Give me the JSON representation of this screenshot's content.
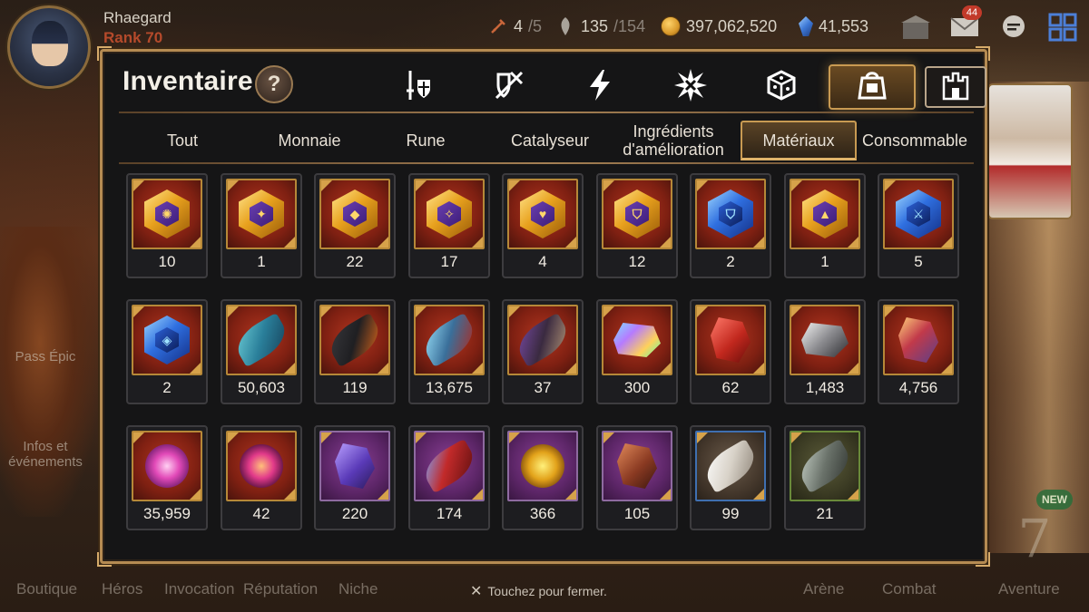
{
  "player": {
    "name": "Rhaegard",
    "rank": "Rank 70"
  },
  "resources": {
    "stamina": {
      "value": "4",
      "max": "/5"
    },
    "energy": {
      "value": "135",
      "max": "/154"
    },
    "gold": "397,062,520",
    "gems": "41,553"
  },
  "top_icons": {
    "mail_badge": "44"
  },
  "panel": {
    "title": "Inventaire",
    "help": "?"
  },
  "category_tabs": [
    {
      "icon": "sword-shield-icon",
      "active": false
    },
    {
      "icon": "crossed-swords-shield-icon",
      "active": false
    },
    {
      "icon": "lightning-icon",
      "active": false
    },
    {
      "icon": "burst-icon",
      "active": false
    },
    {
      "icon": "dice-icon",
      "active": false
    },
    {
      "icon": "backpack-icon",
      "active": true
    },
    {
      "icon": "castle-icon",
      "active": false
    }
  ],
  "sub_tabs": [
    {
      "label": "Tout",
      "active": false
    },
    {
      "label": "Monnaie",
      "active": false
    },
    {
      "label": "Rune",
      "active": false
    },
    {
      "label": "Catalyseur",
      "active": false
    },
    {
      "label": "Ingrédients d'amélioration",
      "active": false
    },
    {
      "label": "Matériaux",
      "active": true
    },
    {
      "label": "Consommable",
      "active": false
    }
  ],
  "items": [
    {
      "qty": "10",
      "kind": "rune-gold",
      "glyph": "✺",
      "bg": "red"
    },
    {
      "qty": "1",
      "kind": "rune-gold",
      "glyph": "✦",
      "bg": "red"
    },
    {
      "qty": "22",
      "kind": "rune-gold",
      "glyph": "◆",
      "bg": "red"
    },
    {
      "qty": "17",
      "kind": "rune-gold",
      "glyph": "✧",
      "bg": "red"
    },
    {
      "qty": "4",
      "kind": "rune-gold",
      "glyph": "♥",
      "bg": "red"
    },
    {
      "qty": "12",
      "kind": "rune-gold",
      "glyph": "⛉",
      "bg": "red"
    },
    {
      "qty": "2",
      "kind": "rune-blue",
      "glyph": "⛉",
      "bg": "red"
    },
    {
      "qty": "1",
      "kind": "rune-gold",
      "glyph": "▲",
      "bg": "red"
    },
    {
      "qty": "5",
      "kind": "rune-blue",
      "glyph": "⚔",
      "bg": "red"
    },
    {
      "qty": "2",
      "kind": "rune-blue",
      "glyph": "◈",
      "bg": "red"
    },
    {
      "qty": "50,603",
      "kind": "claw-teal",
      "bg": "red"
    },
    {
      "qty": "119",
      "kind": "claw-dark-orange",
      "bg": "red"
    },
    {
      "qty": "13,675",
      "kind": "claw-cyan-red",
      "bg": "red"
    },
    {
      "qty": "37",
      "kind": "claw-purple",
      "bg": "red"
    },
    {
      "qty": "300",
      "kind": "crystal-rainbow",
      "bg": "red"
    },
    {
      "qty": "62",
      "kind": "shard-red",
      "bg": "red"
    },
    {
      "qty": "1,483",
      "kind": "crystal-silver",
      "bg": "red"
    },
    {
      "qty": "4,756",
      "kind": "shard-multi",
      "bg": "red"
    },
    {
      "qty": "35,959",
      "kind": "swirl-pink",
      "bg": "red"
    },
    {
      "qty": "42",
      "kind": "swirl-magenta",
      "bg": "red"
    },
    {
      "qty": "220",
      "kind": "shard-violet",
      "bg": "purple"
    },
    {
      "qty": "174",
      "kind": "claw-red-blue",
      "bg": "purple"
    },
    {
      "qty": "366",
      "kind": "swirl-gold",
      "bg": "purple"
    },
    {
      "qty": "105",
      "kind": "shard-rust",
      "bg": "purple"
    },
    {
      "qty": "99",
      "kind": "claw-white",
      "bg": "blue"
    },
    {
      "qty": "21",
      "kind": "claw-grey",
      "bg": "green"
    }
  ],
  "bottom_nav": [
    "Boutique",
    "Héros",
    "Invocation",
    "Réputation",
    "Niche",
    "Arène",
    "Combat",
    "Aventure"
  ],
  "left_side": {
    "pass": "Pass Épic",
    "events": "Infos et événements"
  },
  "close_hint": "Touchez pour fermer.",
  "new_badge": "NEW",
  "emblem": "7",
  "colors": {
    "accent_gold": "#c89a52",
    "panel_bg": "#151516",
    "rank_red": "#b54a2b"
  }
}
